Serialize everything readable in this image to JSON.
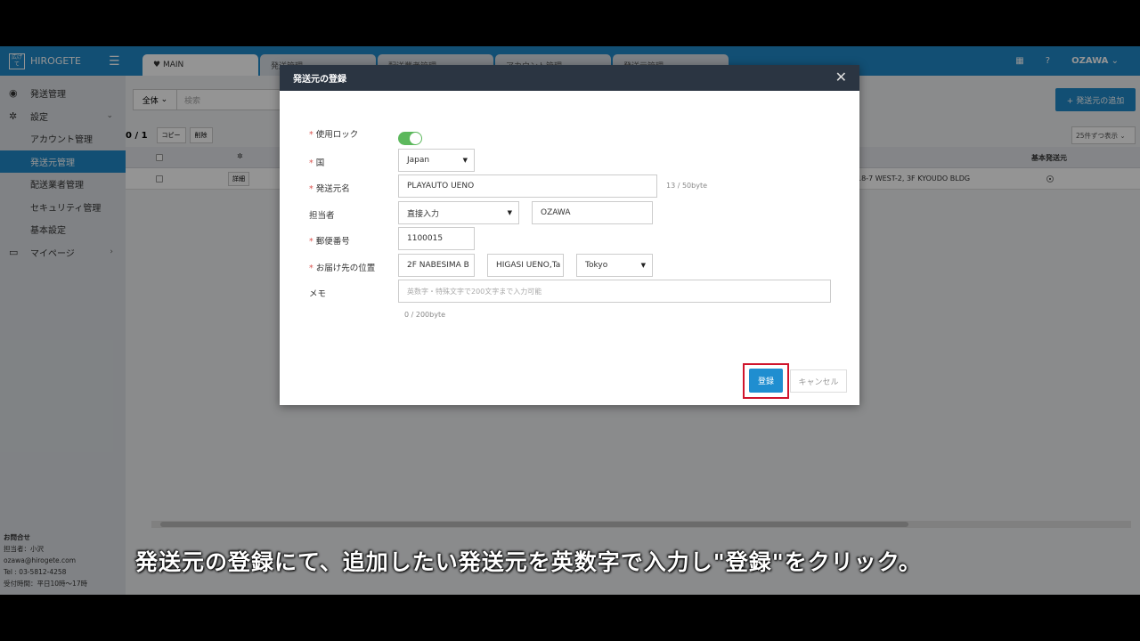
{
  "app": {
    "logo_text": "HIROGETE",
    "user": "OZAWA",
    "tabs": [
      "MAIN",
      "発送管理",
      "配送業者管理",
      "アカウント管理",
      "発送元管理"
    ]
  },
  "sidebar": {
    "items": [
      {
        "label": "発送管理"
      },
      {
        "label": "設定"
      },
      {
        "label": "アカウント管理"
      },
      {
        "label": "発送元管理"
      },
      {
        "label": "配送業者管理"
      },
      {
        "label": "セキュリティ管理"
      },
      {
        "label": "基本設定"
      },
      {
        "label": "マイページ"
      }
    ],
    "contact": {
      "title": "お問合せ",
      "person": "担当者：小沢",
      "email": "ozawa@hirogete.com",
      "tel": "Tel : 03-5812-4258",
      "hours": "受付時間：平日10時〜17時"
    }
  },
  "main": {
    "filter_label": "全体",
    "search_placeholder": "検索",
    "add_button": "+ 発送元の追加",
    "count": "0 / 1",
    "copy_button": "コピー",
    "delete_button": "削除",
    "per_page": "25件ずつ表示",
    "col_default": "基本発送元",
    "row": {
      "detail_button": "詳細",
      "address_tail": "18-7 WEST-2, 3F KYOUDO BLDG"
    }
  },
  "modal": {
    "title": "発送元の登録",
    "fields": {
      "lock_label": "使用ロック",
      "country_label": "国",
      "country_value": "Japan",
      "name_label": "発送元名",
      "name_value": "PLAYAUTO UENO",
      "name_counter": "13 / 50byte",
      "person_label": "担当者",
      "person_mode": "直接入力",
      "person_value": "OZAWA",
      "zip_label": "郵便番号",
      "zip_value": "1100015",
      "address_label": "お届け先の位置",
      "address1": "2F NABESIMA B",
      "address2": "HIGASI UENO,Ta",
      "address_pref": "Tokyo",
      "memo_label": "メモ",
      "memo_placeholder": "英数字・特殊文字で200文字まで入力可能",
      "memo_counter": "0 / 200byte"
    },
    "save_button": "登録",
    "cancel_button": "キャンセル"
  },
  "caption": "発送元の登録にて、追加したい発送元を英数字で入力し\"登録\"をクリック。"
}
